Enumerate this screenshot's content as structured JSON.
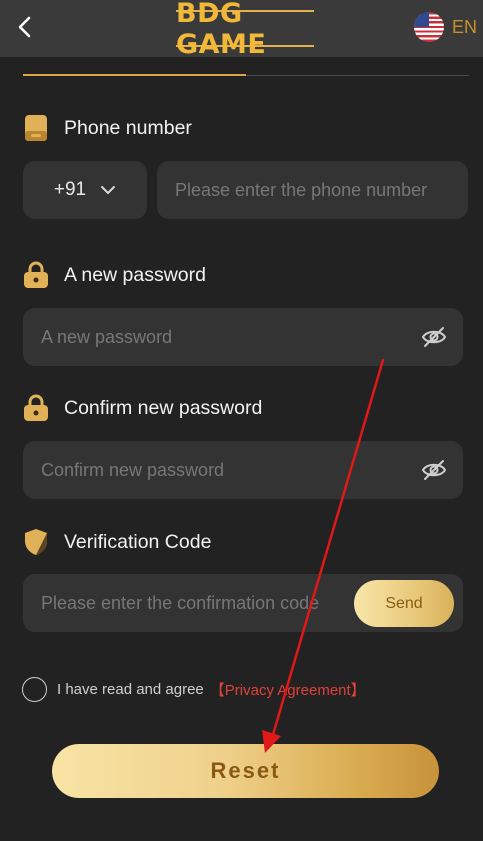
{
  "header": {
    "logo_text": "BDG GAME",
    "language": "EN"
  },
  "phone": {
    "label": "Phone number",
    "country_code": "+91",
    "placeholder": "Please enter the phone number"
  },
  "new_password": {
    "label": "A new password",
    "placeholder": "A new password"
  },
  "confirm_password": {
    "label": "Confirm new password",
    "placeholder": "Confirm new password"
  },
  "verification": {
    "label": "Verification Code",
    "placeholder": "Please enter the confirmation code",
    "send_label": "Send"
  },
  "agreement": {
    "text": "I have read and agree",
    "link": "【Privacy Agreement】"
  },
  "reset_label": "Reset",
  "colors": {
    "accent": "#d9a845",
    "link": "#e0403a",
    "annotation_arrow": "#e01818"
  }
}
